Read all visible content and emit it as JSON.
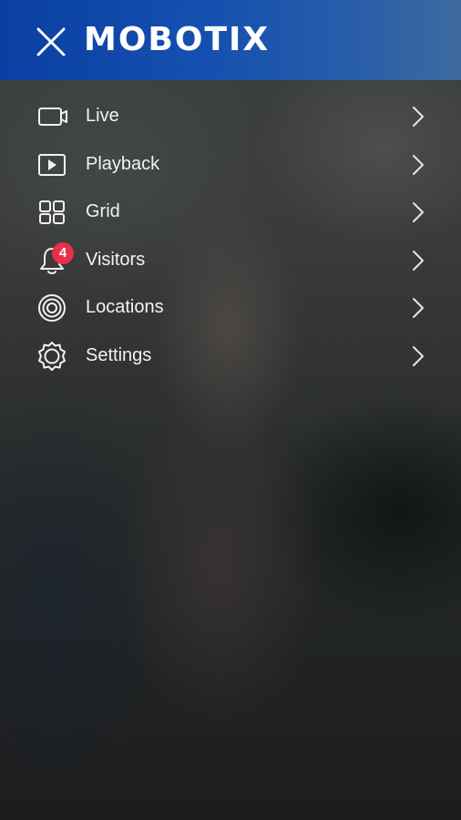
{
  "header": {
    "brand": "MOBOTIX",
    "close_icon": "close-icon",
    "background_color": "#1550b0"
  },
  "menu": {
    "items": [
      {
        "label": "Live",
        "icon": "video-camera-icon"
      },
      {
        "label": "Playback",
        "icon": "playback-icon"
      },
      {
        "label": "Grid",
        "icon": "grid-icon"
      },
      {
        "label": "Visitors",
        "icon": "bell-icon",
        "badge": "4"
      },
      {
        "label": "Locations",
        "icon": "location-rings-icon"
      },
      {
        "label": "Settings",
        "icon": "gear-icon"
      }
    ],
    "chevron_icon": "chevron-right-icon"
  },
  "colors": {
    "badge": "#e8304a",
    "text": "#f2f2f2"
  }
}
